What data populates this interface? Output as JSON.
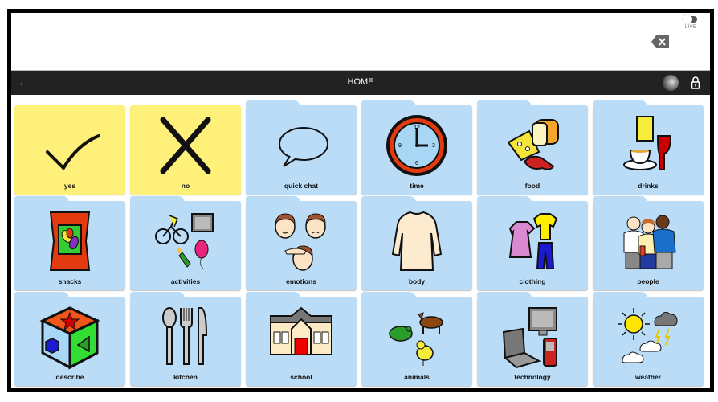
{
  "message_bar": {
    "backspace_icon": "backspace-icon",
    "live_label": "LIVE",
    "live_toggle_on": false
  },
  "nav": {
    "back_icon": "arrow-left-icon",
    "title": "HOME",
    "avatar_icon": "user-avatar",
    "lock_icon": "lock-icon"
  },
  "tiles": [
    {
      "label": "yes",
      "type": "button",
      "color": "#fff07a",
      "icon": "checkmark-icon"
    },
    {
      "label": "no",
      "type": "button",
      "color": "#fff07a",
      "icon": "cross-icon"
    },
    {
      "label": "quick chat",
      "type": "folder",
      "color": "#badcf7",
      "icon": "speech-bubble-icon"
    },
    {
      "label": "time",
      "type": "folder",
      "color": "#badcf7",
      "icon": "clock-icon"
    },
    {
      "label": "food",
      "type": "folder",
      "color": "#badcf7",
      "icon": "food-icon"
    },
    {
      "label": "drinks",
      "type": "folder",
      "color": "#badcf7",
      "icon": "drinks-icon"
    },
    {
      "label": "snacks",
      "type": "folder",
      "color": "#badcf7",
      "icon": "snack-bag-icon"
    },
    {
      "label": "activities",
      "type": "folder",
      "color": "#badcf7",
      "icon": "activities-icon"
    },
    {
      "label": "emotions",
      "type": "folder",
      "color": "#badcf7",
      "icon": "faces-icon"
    },
    {
      "label": "body",
      "type": "folder",
      "color": "#badcf7",
      "icon": "body-icon"
    },
    {
      "label": "clothing",
      "type": "folder",
      "color": "#badcf7",
      "icon": "clothing-icon"
    },
    {
      "label": "people",
      "type": "folder",
      "color": "#badcf7",
      "icon": "people-icon"
    },
    {
      "label": "describe",
      "type": "folder",
      "color": "#badcf7",
      "icon": "shape-cube-icon"
    },
    {
      "label": "kitchen",
      "type": "folder",
      "color": "#badcf7",
      "icon": "cutlery-icon"
    },
    {
      "label": "school",
      "type": "folder",
      "color": "#badcf7",
      "icon": "school-building-icon"
    },
    {
      "label": "animals",
      "type": "folder",
      "color": "#badcf7",
      "icon": "animals-icon"
    },
    {
      "label": "technology",
      "type": "folder",
      "color": "#badcf7",
      "icon": "devices-icon"
    },
    {
      "label": "weather",
      "type": "folder",
      "color": "#badcf7",
      "icon": "weather-icon"
    }
  ]
}
